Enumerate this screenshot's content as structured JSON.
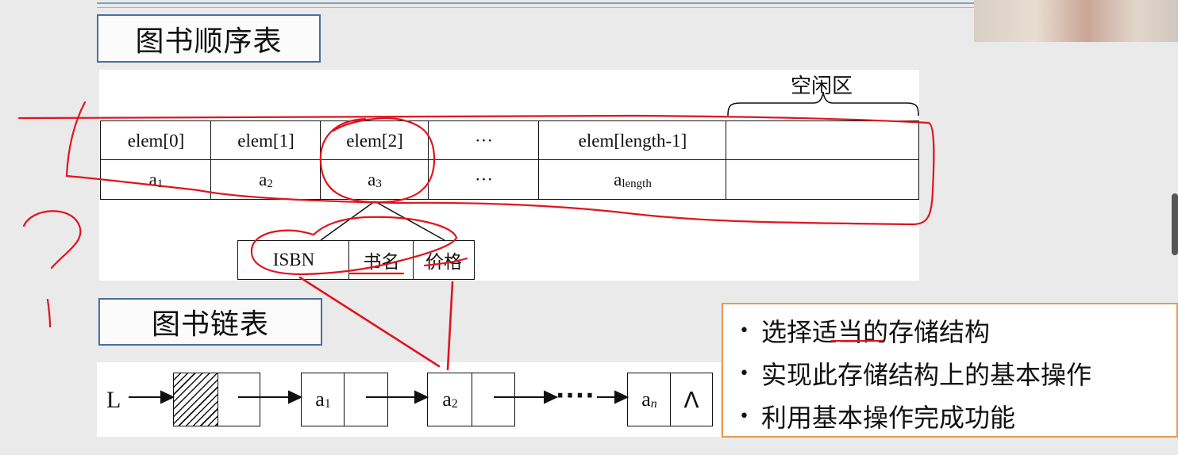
{
  "slide": {
    "seq_title": "图书顺序表",
    "link_title": "图书链表"
  },
  "array": {
    "free_label": "空闲区",
    "headers": [
      "elem[0]",
      "elem[1]",
      "elem[2]",
      "···",
      "elem[length-1]",
      ""
    ],
    "values": [
      {
        "base": "a",
        "sub": "1"
      },
      {
        "base": "a",
        "sub": "2"
      },
      {
        "base": "a",
        "sub": "3"
      },
      {
        "base": "···",
        "sub": ""
      },
      {
        "base": "a",
        "sub": "length"
      },
      {
        "base": "",
        "sub": ""
      }
    ]
  },
  "record_fields": [
    "ISBN",
    "书名",
    "价格"
  ],
  "linked_list": {
    "head_label": "L",
    "nodes": [
      {
        "base": "a",
        "sub": "1"
      },
      {
        "base": "a",
        "sub": "2"
      },
      {
        "base": "a",
        "sub": "n"
      }
    ],
    "ellipsis": "····",
    "null_symbol": "Λ"
  },
  "bullets": [
    "选择适当的存储结构",
    "实现此存储结构上的基本操作",
    "利用基本操作完成功能"
  ],
  "colors": {
    "annotation_red": "#e0141e",
    "title_border": "#4a6fa0",
    "bullet_border": "#e69a52"
  }
}
